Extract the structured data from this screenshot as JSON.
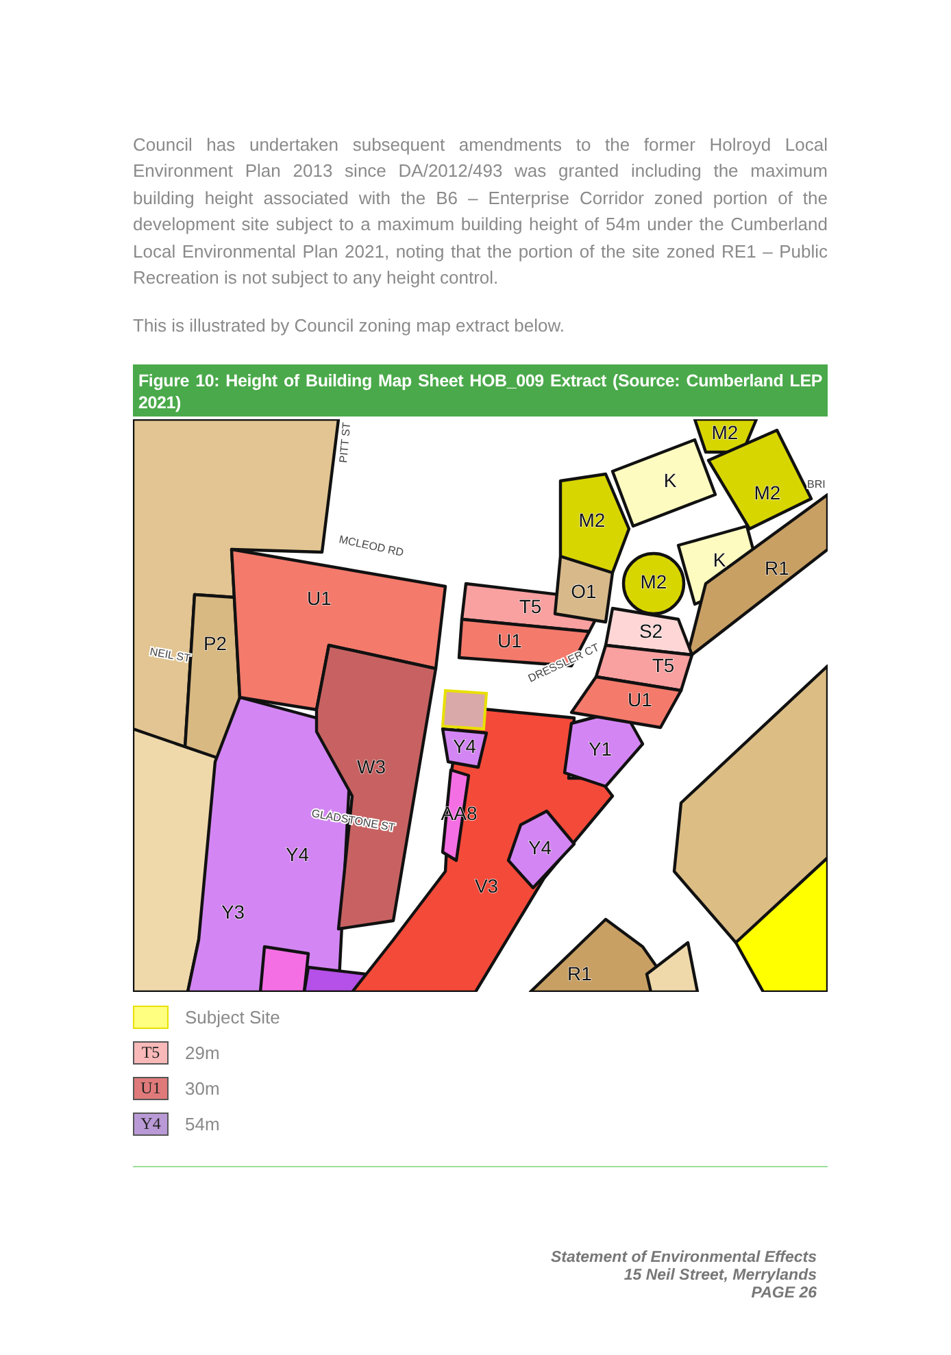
{
  "body": {
    "paragraphs": [
      "Council has undertaken subsequent amendments to the former Holroyd Local Environment Plan 2013 since DA/2012/493 was granted including the maximum building height associated with the B6 – Enterprise Corridor zoned portion of the development site subject to a maximum building height of 54m under the Cumberland Local Environmental Plan 2021, noting that the portion of the site zoned RE1 – Public Recreation is not subject to any height control.",
      "This is illustrated by Council zoning map extract below."
    ]
  },
  "figure": {
    "caption": "Figure 10: Height of Building Map Sheet HOB_009 Extract (Source: Cumberland LEP 2021)",
    "street_labels": [
      "PITT ST",
      "MCLEOD RD",
      "NEIL ST",
      "GLADSTONE ST",
      "DRESSLER CT",
      "BRI"
    ],
    "zone_labels": [
      "M2",
      "K",
      "M2",
      "M2",
      "K",
      "R1",
      "O1",
      "M2",
      "U1",
      "T5",
      "P2",
      "U1",
      "S2",
      "T5",
      "U1",
      "Y4",
      "Y1",
      "W3",
      "AA8",
      "Y4",
      "Y4",
      "V3",
      "Y3",
      "R1"
    ]
  },
  "legend": [
    {
      "text": "Subject Site",
      "color": "#ffff80"
    },
    {
      "code": "T5",
      "text": "29m",
      "color": "#f9b9b9"
    },
    {
      "code": "U1",
      "text": "30m",
      "color": "#e07a7a"
    },
    {
      "code": "Y4",
      "text": "54m",
      "color": "#b99ad6"
    }
  ],
  "footer": {
    "lines": [
      "Statement of Environmental Effects",
      "15 Neil Street, Merrylands",
      "PAGE 26"
    ]
  }
}
